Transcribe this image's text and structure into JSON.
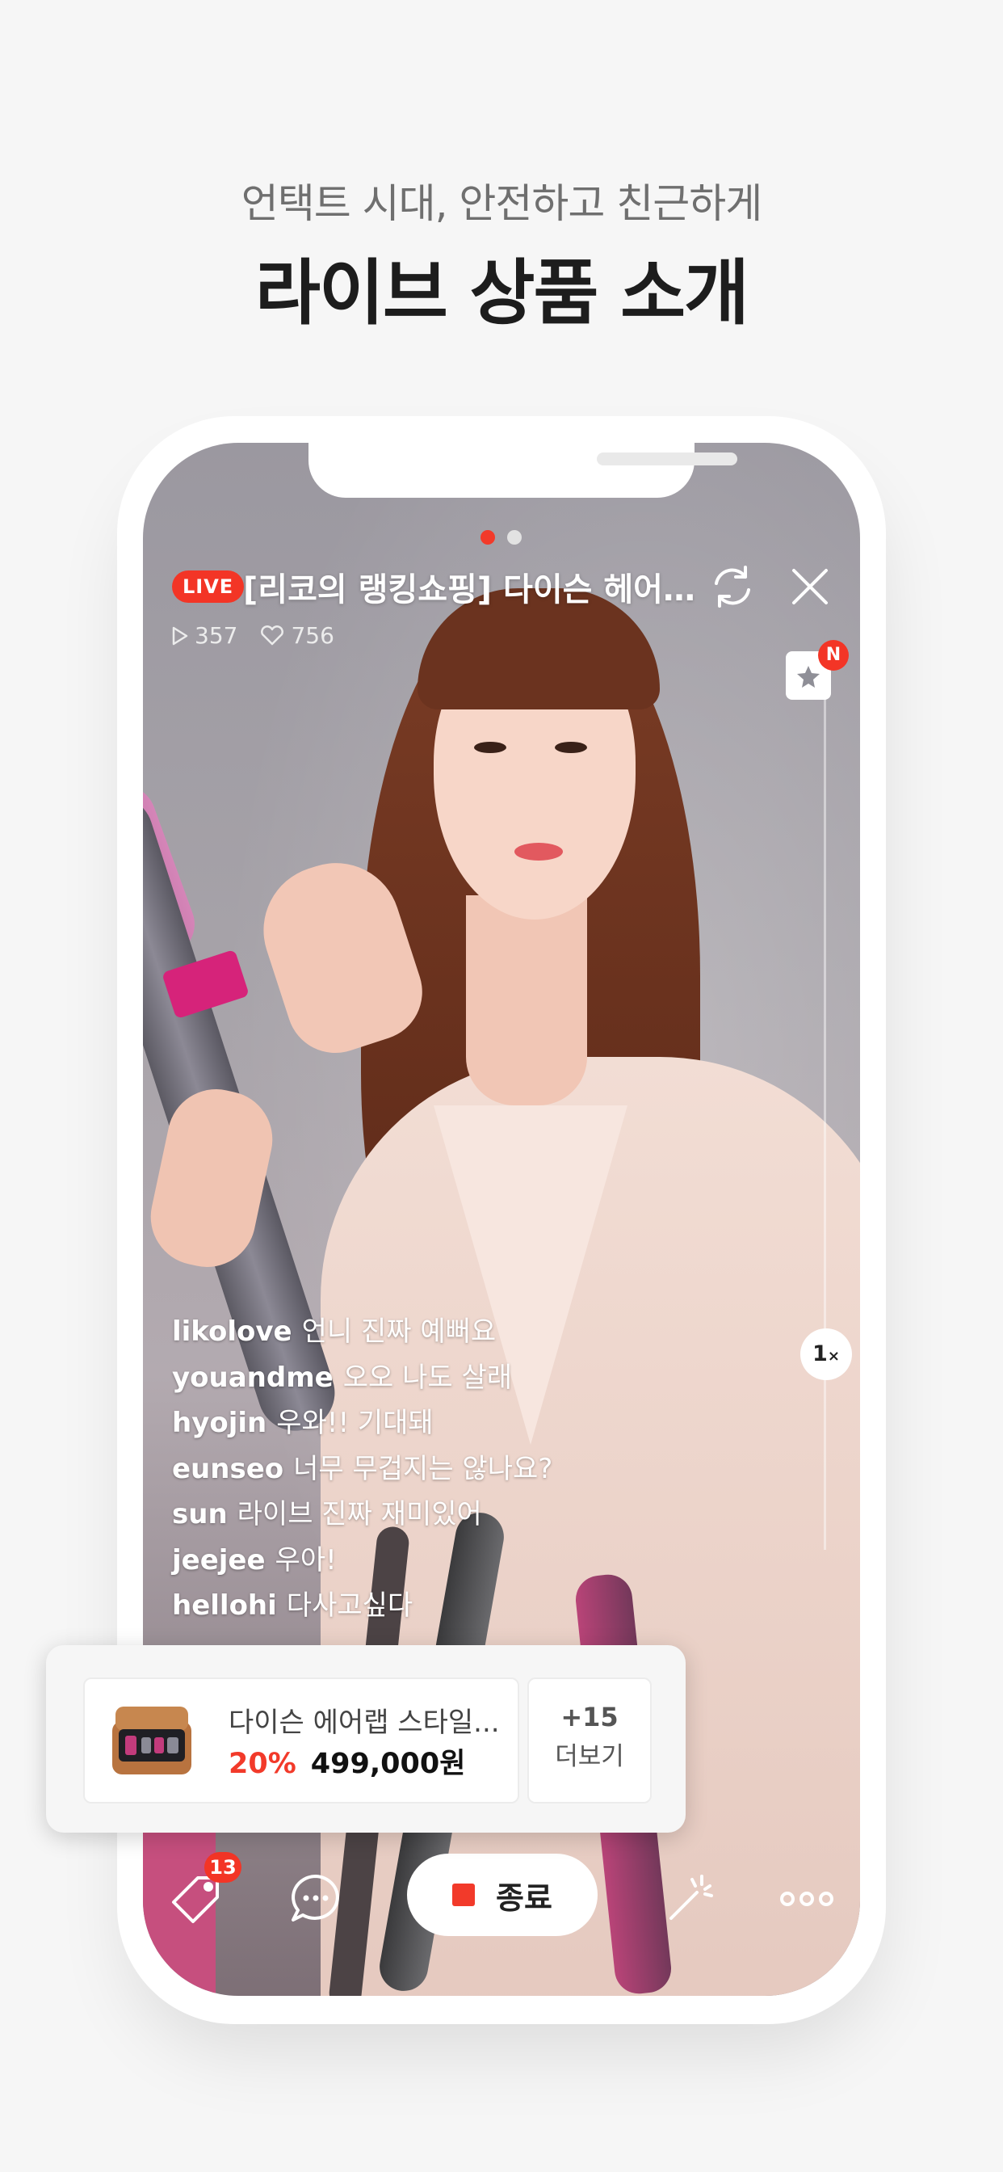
{
  "header": {
    "subtitle": "언택트 시대, 안전하고 친근하게",
    "title": "라이브 상품 소개"
  },
  "live": {
    "badge": "LIVE",
    "title": "[리코의 랭킹쇼핑] 다이슨 헤어케...",
    "views": "357",
    "likes": "756",
    "new_badge": "N",
    "speed": "1",
    "speed_suffix": "×",
    "carousel_pages": 2,
    "carousel_active": 1
  },
  "chat": [
    {
      "user": "likolove",
      "message": "언니 진짜 예뻐요"
    },
    {
      "user": "youandme",
      "message": "오오 나도 살래"
    },
    {
      "user": "hyojin",
      "message": "우와!! 기대돼"
    },
    {
      "user": "eunseo",
      "message": "너무 무겁지는 않나요?"
    },
    {
      "user": "sun",
      "message": "라이브 진짜 재미있어"
    },
    {
      "user": "jeejee",
      "message": "우아!"
    },
    {
      "user": "hellohi",
      "message": "다사고싶다"
    }
  ],
  "product": {
    "name": "다이슨 에어랩 스타일...",
    "discount": "20%",
    "price": "499,000원",
    "more_count": "+15",
    "more_label": "더보기"
  },
  "bottom": {
    "coupon_count": "13",
    "end_label": "종료"
  },
  "colors": {
    "accent": "#f23a2a",
    "background": "#f6f6f6",
    "title": "#1d1d1d"
  },
  "icons": [
    "refresh-icon",
    "close-icon",
    "play-icon",
    "heart-icon",
    "store-icon",
    "coupon-tag-icon",
    "chat-icon",
    "stop-icon",
    "magic-wand-icon",
    "more-dots-icon"
  ]
}
